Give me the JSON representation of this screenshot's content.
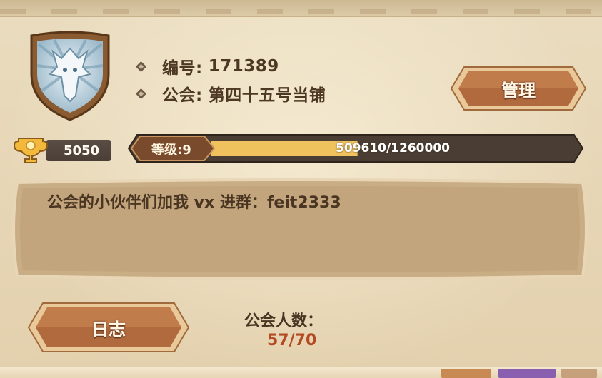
{
  "guild": {
    "id_label": "编号:",
    "id_value": "171389",
    "guild_label": "公会:",
    "guild_name": "第四十五号当铺"
  },
  "buttons": {
    "manage_label": "管理",
    "log_label": "日志"
  },
  "trophy": {
    "value": "5050",
    "icon": "trophy-icon"
  },
  "level": {
    "label": "等级:9",
    "exp_text": "509610/1260000",
    "progress": 0.4045
  },
  "notice": {
    "text": "公会的小伙伴们加我 vx 进群：feit2333"
  },
  "members": {
    "label": "公会人数：",
    "value": "57/70"
  },
  "colors": {
    "background": "#e7d6b4",
    "text_brown": "#4a3522",
    "member_count_red": "#b34a24",
    "button_brown": "#8a4a2c",
    "progress_fill": "#f0c25e"
  }
}
